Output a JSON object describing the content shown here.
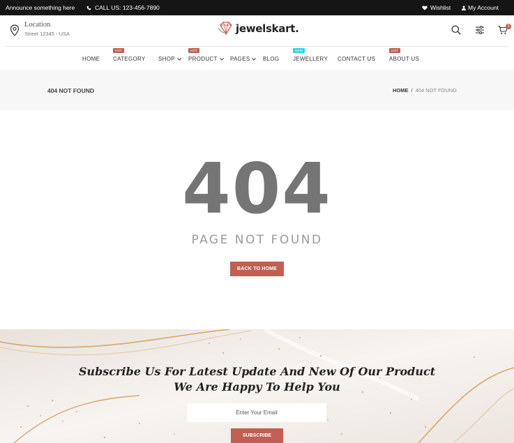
{
  "topbar": {
    "announce": "Announce something here",
    "call": "CALL US: 123-456-7890",
    "wishlist": "Wishlist",
    "account": "My Account"
  },
  "header": {
    "location_title": "Location",
    "location_sub": "Street 12345 - USA",
    "logo_text": "jewelskart.",
    "cart_count": "3"
  },
  "nav": {
    "items": [
      {
        "label": "HOME",
        "tag": ""
      },
      {
        "label": "CATEGORY",
        "tag": "HOT"
      },
      {
        "label": "SHOP",
        "tag": ""
      },
      {
        "label": "PRODUCT",
        "tag": "HOT"
      },
      {
        "label": "PAGES",
        "tag": ""
      },
      {
        "label": "BLOG",
        "tag": ""
      },
      {
        "label": "JEWELLERY",
        "tag": "NEW"
      },
      {
        "label": "CONTACT US",
        "tag": ""
      },
      {
        "label": "ABOUT US",
        "tag": "HOT"
      }
    ]
  },
  "breadcrumb": {
    "title": "404 NOT FOUND",
    "home": "HOME",
    "separator": "/",
    "current": "404 NOT FOUND"
  },
  "error": {
    "code": "404",
    "message": "PAGE NOT FOUND",
    "button": "BACK TO HOME"
  },
  "subscribe": {
    "line1": "Subscribe Us For Latest Update And New Of Our Product",
    "line2": "We Are Happy To Help You",
    "placeholder": "Enter Your Email",
    "button": "SUBSCRIBE"
  },
  "colors": {
    "accent": "#c05f52",
    "new_tag": "#2dd3e3",
    "topbar": "#151515"
  },
  "icons": [
    "phone-icon",
    "heart-icon",
    "user-icon",
    "location-pin-icon",
    "diamond-logo-icon",
    "search-icon",
    "filter-icon",
    "cart-icon",
    "chevron-down-icon"
  ]
}
